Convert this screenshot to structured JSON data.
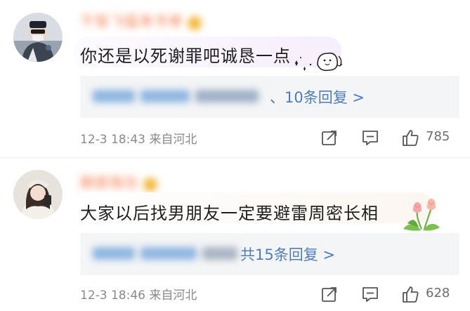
{
  "comments": [
    {
      "username_blurred": "干饭飞猛来书单",
      "text": "你还是以死谢罪吧诚恳一点",
      "reply_link": "、10条回复 >",
      "meta": "12-3 18:43 来自河北",
      "likes": "785",
      "avatar_icon": "avatar-user-mask-icon",
      "sticker_icon": "cute-blob-sticker-icon"
    },
    {
      "username_blurred": "脚部我在",
      "text": "大家以后找男朋友一定要避雷周密长相",
      "reply_link": "共15条回复 >",
      "meta": "12-3 18:46 来自河北",
      "likes": "628",
      "avatar_icon": "avatar-user-woman-icon",
      "sticker_icon": "tulip-flowers-sticker-icon"
    }
  ],
  "colors": {
    "link": "#4f7dbb",
    "meta": "#8a8a8a",
    "reply_bg": "#f4f5f7"
  }
}
